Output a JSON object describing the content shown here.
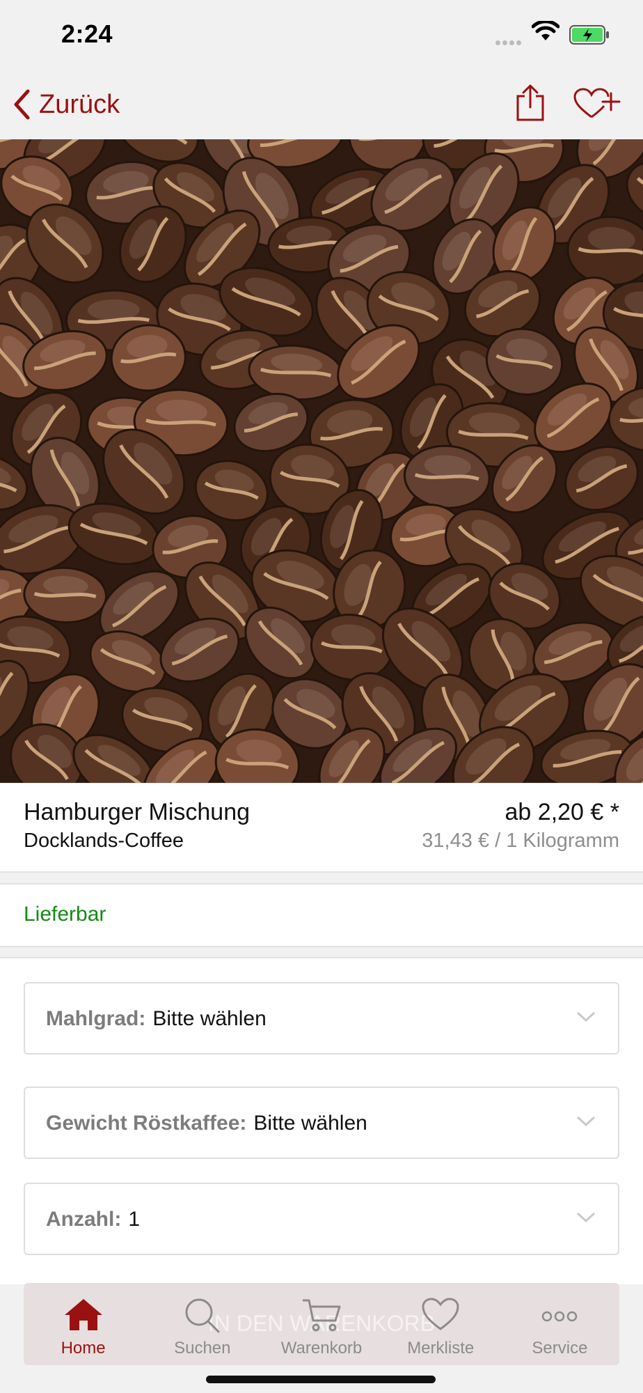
{
  "status": {
    "time": "2:24"
  },
  "nav": {
    "back_label": "Zurück",
    "share_icon": "share-icon",
    "wishlist_icon": "heart-plus-icon"
  },
  "hero": {
    "image": "coffee-beans-photo"
  },
  "product": {
    "name": "Hamburger Mischung",
    "brand": "Docklands-Coffee",
    "price": "ab 2,20 € *",
    "unit_price": "31,43 € / 1 Kilogramm"
  },
  "availability": {
    "label": "Lieferbar"
  },
  "options": [
    {
      "label": "Mahlgrad:",
      "value": "Bitte wählen"
    },
    {
      "label": "Gewicht Röstkaffee:",
      "value": "Bitte wählen"
    },
    {
      "label": "Anzahl:",
      "value": "1"
    }
  ],
  "cart_button": {
    "label": "IN DEN WARENKORB"
  },
  "tabs": [
    {
      "label": "Home",
      "icon": "home-icon",
      "active": true
    },
    {
      "label": "Suchen",
      "icon": "search-icon",
      "active": false
    },
    {
      "label": "Warenkorb",
      "icon": "cart-icon",
      "active": false
    },
    {
      "label": "Merkliste",
      "icon": "heart-icon",
      "active": false
    },
    {
      "label": "Service",
      "icon": "more-icon",
      "active": false
    }
  ],
  "colors": {
    "accent": "#9a1111",
    "available": "#148a14",
    "muted": "#8e8e8e"
  }
}
